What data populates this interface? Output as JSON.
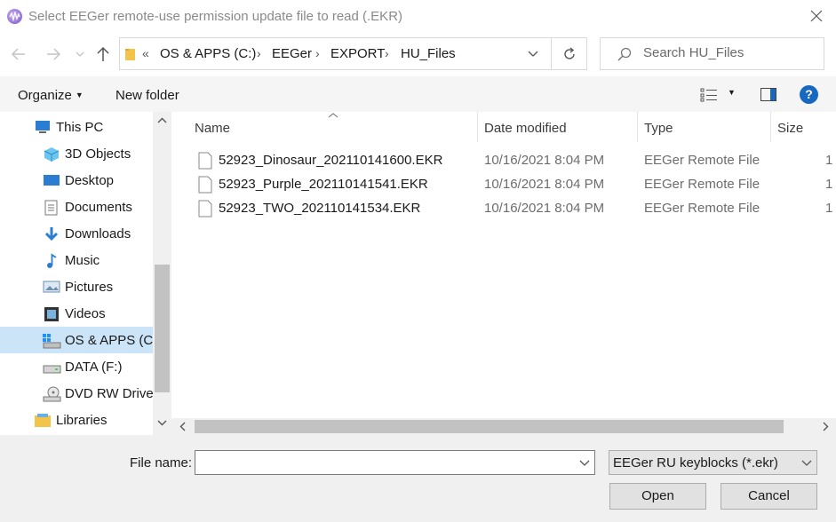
{
  "window": {
    "title": "Select EEGer remote-use permission update file to read (.EKR)"
  },
  "address": {
    "overflow": "«",
    "crumbs": [
      "OS & APPS (C:)",
      "EEGer",
      "EXPORT",
      "HU_Files"
    ]
  },
  "search": {
    "placeholder": "Search HU_Files"
  },
  "commands": {
    "organize": "Organize",
    "new_folder": "New folder"
  },
  "nav": {
    "items": [
      {
        "label": "This PC",
        "icon": "this-pc-icon"
      },
      {
        "label": "3D Objects",
        "icon": "3d-objects-icon"
      },
      {
        "label": "Desktop",
        "icon": "desktop-icon"
      },
      {
        "label": "Documents",
        "icon": "documents-icon"
      },
      {
        "label": "Downloads",
        "icon": "downloads-icon"
      },
      {
        "label": "Music",
        "icon": "music-icon"
      },
      {
        "label": "Pictures",
        "icon": "pictures-icon"
      },
      {
        "label": "Videos",
        "icon": "videos-icon"
      },
      {
        "label": "OS & APPS (C:)",
        "icon": "drive-c-icon",
        "selected": true
      },
      {
        "label": "DATA (F:)",
        "icon": "drive-icon"
      },
      {
        "label": "DVD RW Drive",
        "icon": "dvd-icon"
      },
      {
        "label": "Libraries",
        "icon": "libraries-icon"
      }
    ]
  },
  "columns": {
    "name": "Name",
    "date": "Date modified",
    "type": "Type",
    "size": "Size"
  },
  "files": [
    {
      "name": "52923_Dinosaur_202110141600.EKR",
      "date": "10/16/2021 8:04 PM",
      "type": "EEGer Remote File",
      "size": "1"
    },
    {
      "name": "52923_Purple_202110141541.EKR",
      "date": "10/16/2021 8:04 PM",
      "type": "EEGer Remote File",
      "size": "1"
    },
    {
      "name": "52923_TWO_202110141534.EKR",
      "date": "10/16/2021 8:04 PM",
      "type": "EEGer Remote File",
      "size": "1"
    }
  ],
  "footer": {
    "file_name_label": "File name:",
    "file_name_value": "",
    "file_type": "EEGer RU keyblocks (*.ekr)",
    "open_label": "Open",
    "cancel_label": "Cancel"
  },
  "colors": {
    "accent": "#1868c2",
    "selection": "#cce4f7",
    "folder": "#f3c44a"
  }
}
